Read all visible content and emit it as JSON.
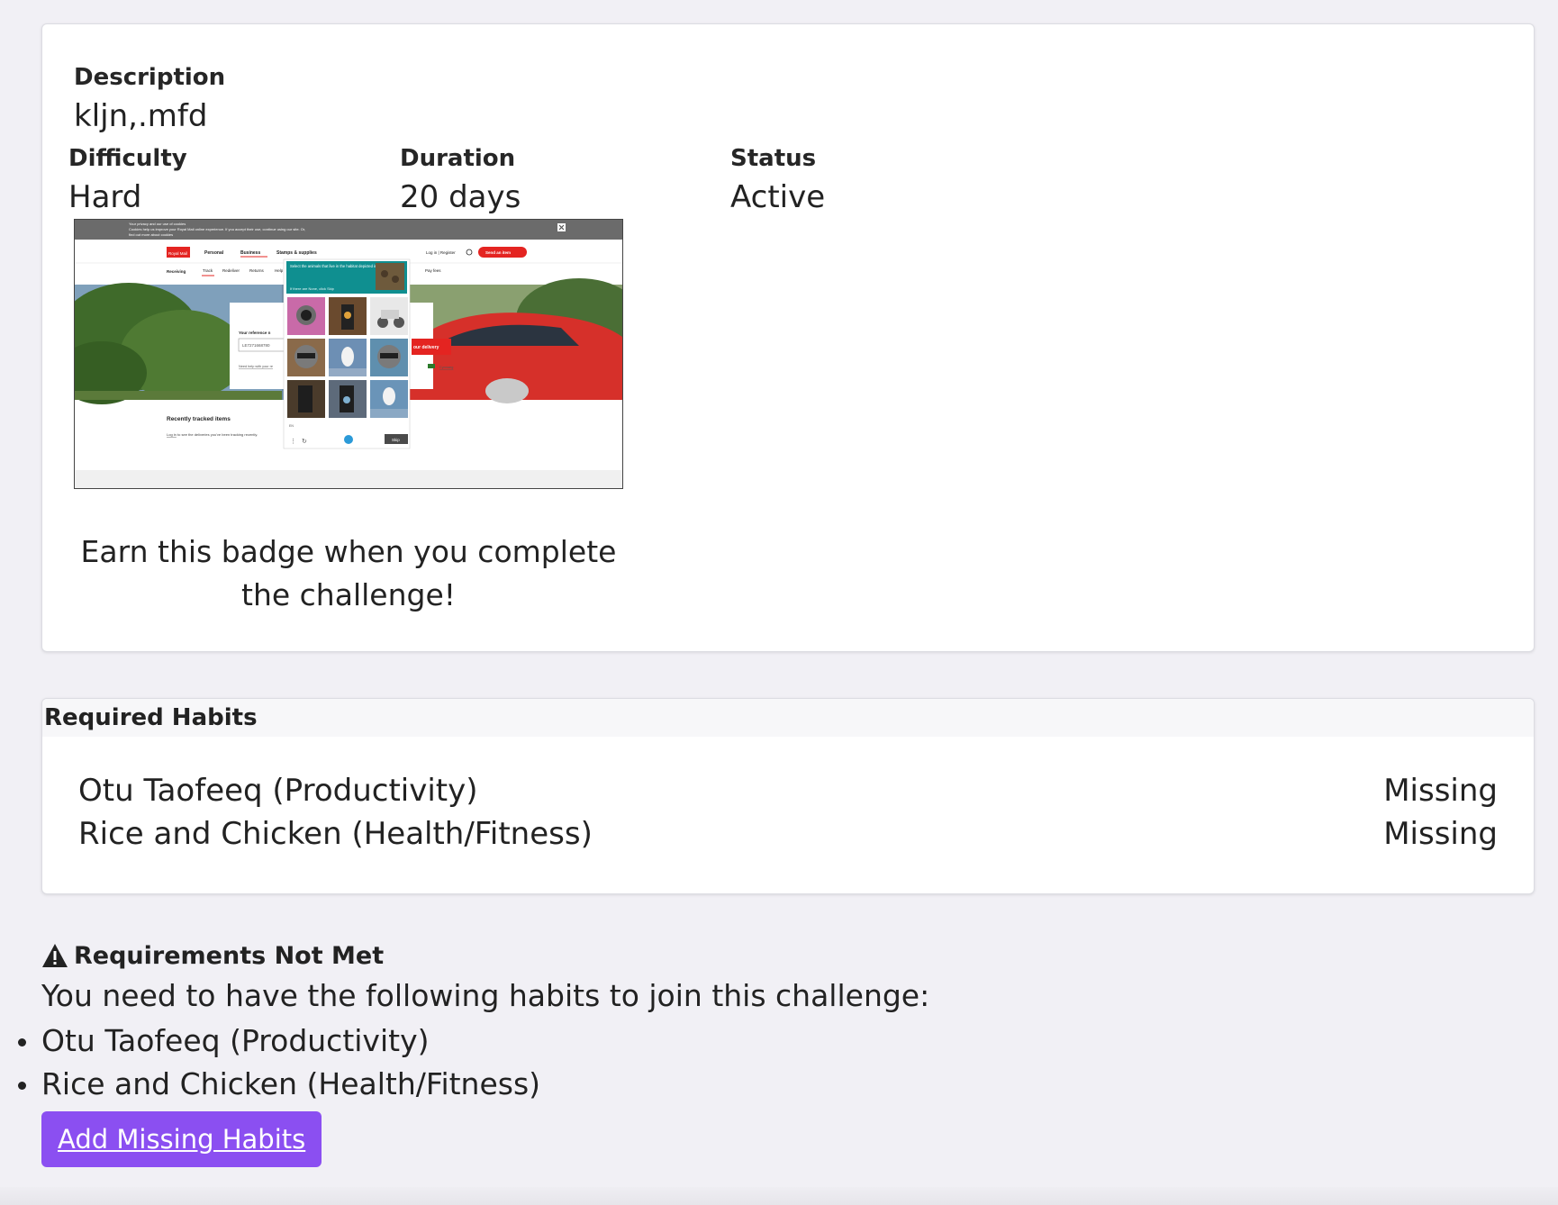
{
  "details": {
    "description_label": "Description",
    "description_value": "kljn,.mfd",
    "difficulty_label": "Difficulty",
    "difficulty_value": "Hard",
    "duration_label": "Duration",
    "duration_value": "20 days",
    "status_label": "Status",
    "status_value": "Active",
    "badge_caption": "Earn this badge when you complete the challenge!"
  },
  "badge_screenshot": {
    "cookie_banner_lines": [
      "Your privacy and our use of cookies",
      "Cookies help us improve your Royal Mail online experience. If you accept their use, continue using our site. Or,",
      "find out more about cookies"
    ],
    "logo_text": "Royal Mail",
    "nav": [
      "Personal",
      "Business",
      "Stamps & supplies"
    ],
    "login_text": "Log in | Register",
    "send_button": "Send an item",
    "subnav": [
      "Receiving",
      "Track",
      "Redeliver",
      "Returns",
      "Help",
      "Pay fees"
    ],
    "reference_label": "Your reference n",
    "reference_value": "LE7271668780",
    "help_link": "Need help with your re",
    "track_button": "our delivery",
    "cymraeg": "Cymraeg",
    "captcha_prompt": "Select the animals that live in the habitat depicted in the example",
    "captcha_hint": "If there are None, click Skip",
    "captcha_lang": "EN",
    "skip_button": "Skip",
    "recent_title": "Recently tracked items",
    "recent_text_link": "Log in",
    "recent_text_rest": "to see the deliveries you've been tracking recently."
  },
  "required_habits": {
    "header": "Required Habits",
    "items": [
      {
        "name": "Otu Taofeeq (Productivity)",
        "status": "Missing"
      },
      {
        "name": "Rice and Chicken (Health/Fitness)",
        "status": "Missing"
      }
    ]
  },
  "requirements": {
    "title": "Requirements Not Met",
    "message": "You need to have the following habits to join this challenge:",
    "missing": [
      "Otu Taofeeq (Productivity)",
      "Rice and Chicken (Health/Fitness)"
    ],
    "button_label": "Add Missing Habits"
  },
  "colors": {
    "accent": "#8b4ff1",
    "page_bg": "#f1f0f5",
    "royal_mail_red": "#e42421",
    "captcha_teal": "#0f8f90"
  }
}
